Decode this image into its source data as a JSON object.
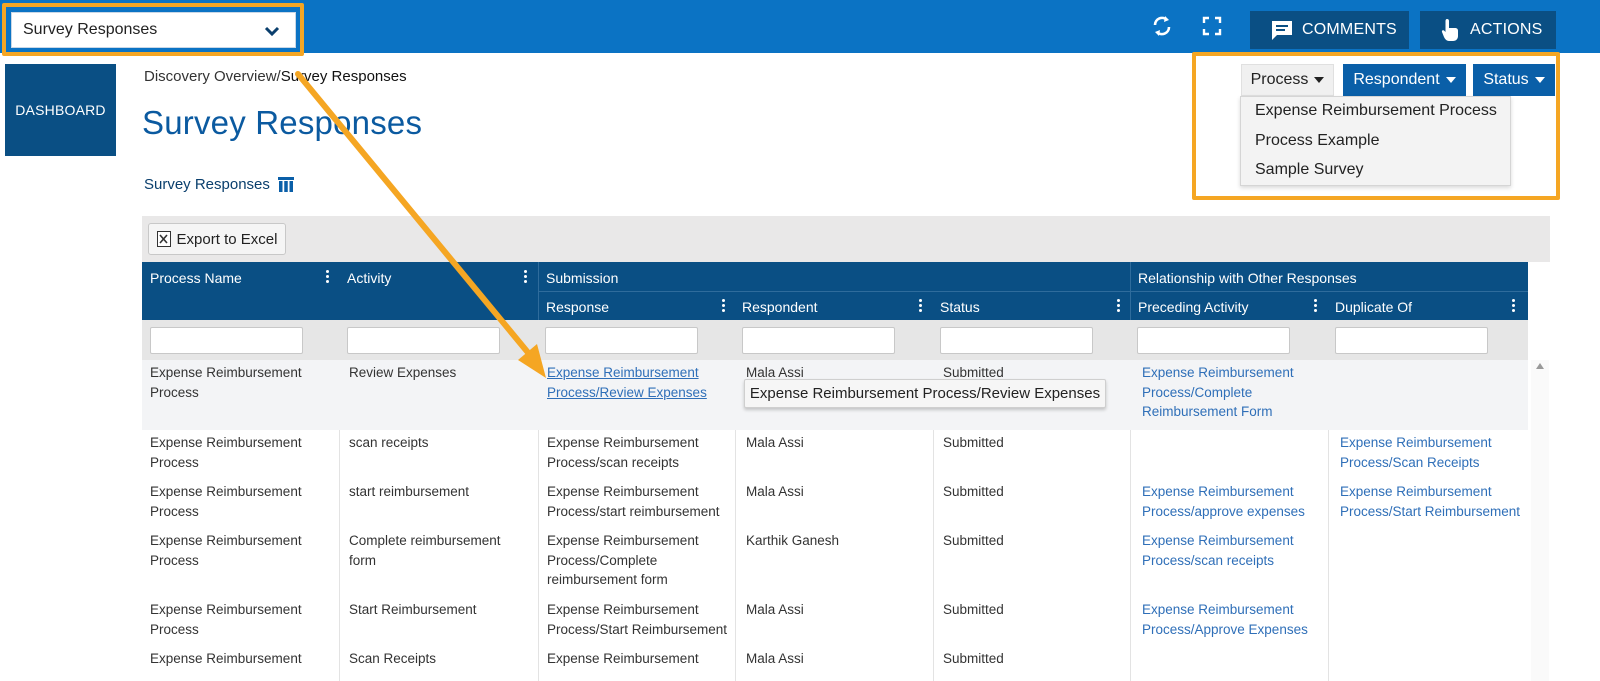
{
  "topbar": {
    "view_select_value": "Survey Responses",
    "comments_label": "COMMENTS",
    "actions_label": "ACTIONS",
    "icons": [
      "refresh-icon",
      "fullscreen-icon",
      "comment-icon",
      "hand-pointer-icon",
      "chevron-down-icon"
    ]
  },
  "sidebar": {
    "dashboard_label": "DASHBOARD"
  },
  "breadcrumb": {
    "parent": "Discovery Overview",
    "separator": "/",
    "current": "Survey Responses"
  },
  "page": {
    "title": "Survey Responses",
    "section_label": "Survey Responses"
  },
  "filters": {
    "process_label": "Process",
    "respondent_label": "Respondent",
    "status_label": "Status",
    "process_options": [
      "Expense Reimbursement Process",
      "Process Example",
      "Sample Survey"
    ]
  },
  "grid": {
    "export_label": "Export to Excel",
    "group_headers": {
      "submission": "Submission",
      "relationship": "Relationship with Other Responses"
    },
    "columns": {
      "process_name": "Process Name",
      "activity": "Activity",
      "response": "Response",
      "respondent": "Respondent",
      "status": "Status",
      "preceding_activity": "Preceding Activity",
      "duplicate_of": "Duplicate Of"
    },
    "rows": [
      {
        "process_name": [
          "Expense Reimbursement",
          "Process"
        ],
        "activity": [
          "Review Expenses"
        ],
        "response": [
          "Expense Reimbursement",
          "Process/Review Expenses"
        ],
        "respondent": "Mala Assi",
        "status": "Submitted",
        "preceding": [
          "Expense Reimbursement",
          "Process/Complete",
          "Reimbursement Form"
        ],
        "duplicate": []
      },
      {
        "process_name": [
          "Expense Reimbursement",
          "Process"
        ],
        "activity": [
          "scan receipts"
        ],
        "response": [
          "Expense Reimbursement",
          "Process/scan receipts"
        ],
        "respondent": "Mala Assi",
        "status": "Submitted",
        "preceding": [],
        "duplicate": [
          "Expense Reimbursement",
          "Process/Scan Receipts"
        ]
      },
      {
        "process_name": [
          "Expense Reimbursement",
          "Process"
        ],
        "activity": [
          "start reimbursement"
        ],
        "response": [
          "Expense Reimbursement",
          "Process/start reimbursement"
        ],
        "respondent": "Mala Assi",
        "status": "Submitted",
        "preceding": [
          "Expense Reimbursement",
          "Process/approve expenses"
        ],
        "duplicate": [
          "Expense Reimbursement",
          "Process/Start Reimbursement"
        ]
      },
      {
        "process_name": [
          "Expense Reimbursement",
          "Process"
        ],
        "activity": [
          "Complete reimbursement",
          "form"
        ],
        "response": [
          "Expense Reimbursement",
          "Process/Complete",
          "reimbursement form"
        ],
        "respondent": "Karthik Ganesh",
        "status": "Submitted",
        "preceding": [
          "Expense Reimbursement",
          "Process/scan receipts"
        ],
        "duplicate": []
      },
      {
        "process_name": [
          "Expense Reimbursement",
          "Process"
        ],
        "activity": [
          "Start Reimbursement"
        ],
        "response": [
          "Expense Reimbursement",
          "Process/Start Reimbursement"
        ],
        "respondent": "Mala Assi",
        "status": "Submitted",
        "preceding": [
          "Expense Reimbursement",
          "Process/Approve Expenses"
        ],
        "duplicate": []
      },
      {
        "process_name": [
          "Expense Reimbursement"
        ],
        "activity": [
          "Scan Receipts"
        ],
        "response": [
          "Expense Reimbursement"
        ],
        "respondent": "Mala Assi",
        "status": "Submitted",
        "preceding": [],
        "duplicate": []
      }
    ]
  },
  "tooltip": {
    "text": "Expense Reimbursement Process/Review Expenses"
  },
  "colors": {
    "topbar": "#0b73c4",
    "header": "#0a4f84",
    "title": "#0b5aa0",
    "link": "#2f6fb8",
    "callout": "#f5a623"
  }
}
